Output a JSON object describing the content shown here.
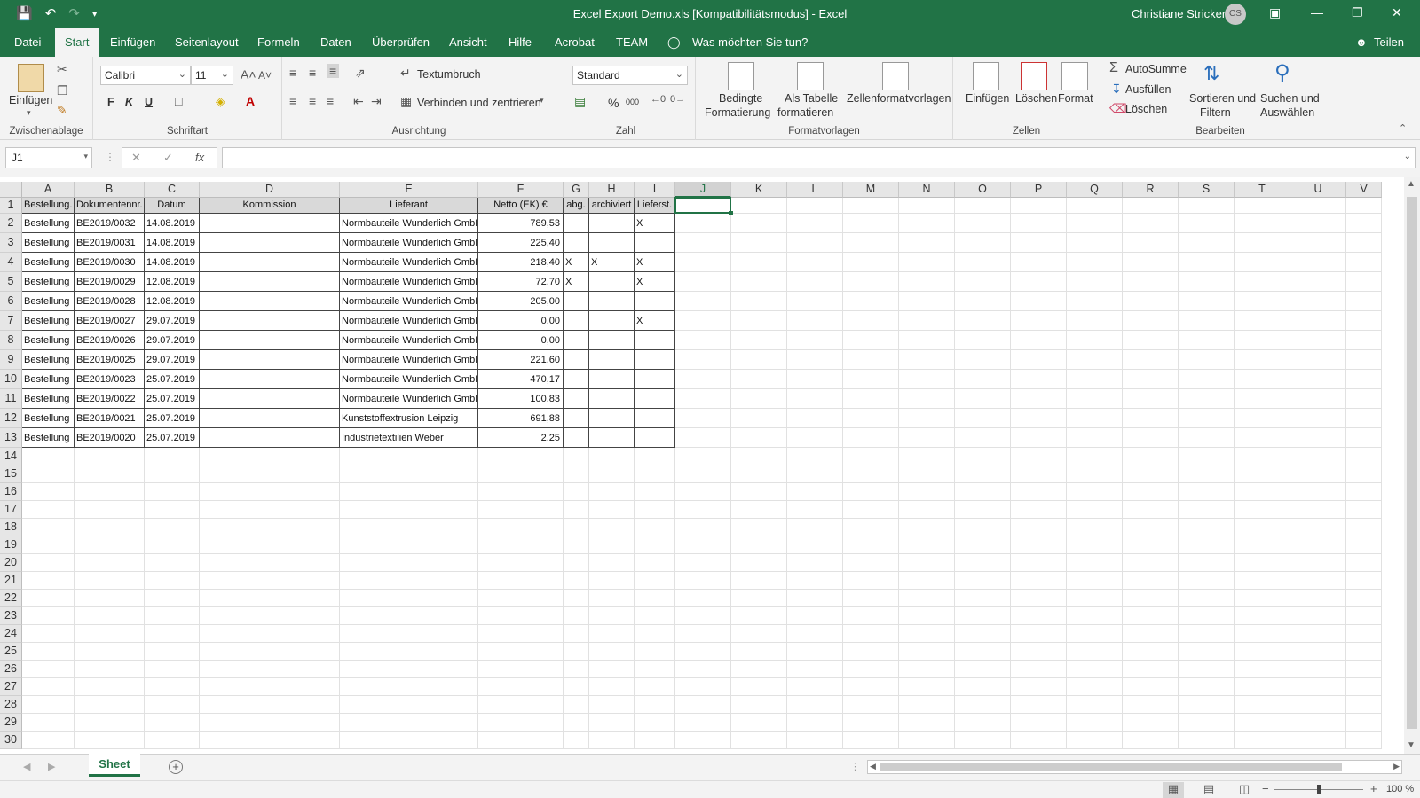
{
  "titlebar": {
    "title": "Excel Export Demo.xls  [Kompatibilitätsmodus]  -  Excel",
    "user": "Christiane Stricker",
    "initials": "CS"
  },
  "menu": {
    "tabs": [
      "Datei",
      "Start",
      "Einfügen",
      "Seitenlayout",
      "Formeln",
      "Daten",
      "Überprüfen",
      "Ansicht",
      "Hilfe",
      "Acrobat",
      "TEAM"
    ],
    "active": "Start",
    "tellme": "Was möchten Sie tun?",
    "share": "Teilen"
  },
  "ribbon": {
    "clipboard": {
      "paste": "Einfügen",
      "label": "Zwischenablage"
    },
    "font": {
      "name": "Calibri",
      "size": "11",
      "bold": "F",
      "italic": "K",
      "underline": "U",
      "label": "Schriftart"
    },
    "alignment": {
      "wrap": "Textumbruch",
      "merge": "Verbinden und zentrieren",
      "label": "Ausrichtung"
    },
    "number": {
      "format": "Standard",
      "percent": "%",
      "thousands": "000",
      "label": "Zahl"
    },
    "styles": {
      "conditional_1": "Bedingte",
      "conditional_2": "Formatierung",
      "astable_1": "Als Tabelle",
      "astable_2": "formatieren",
      "cellstyles": "Zellenformatvorlagen",
      "label": "Formatvorlagen"
    },
    "cells": {
      "insert": "Einfügen",
      "delete": "Löschen",
      "format": "Format",
      "label": "Zellen"
    },
    "editing": {
      "autosum": "AutoSumme",
      "fill": "Ausfüllen",
      "clear": "Löschen",
      "sort_1": "Sortieren und",
      "sort_2": "Filtern",
      "find_1": "Suchen und",
      "find_2": "Auswählen",
      "label": "Bearbeiten"
    }
  },
  "formula": {
    "namebox": "J1",
    "fx": "fx",
    "content": ""
  },
  "sheet": {
    "columns": [
      "A",
      "B",
      "C",
      "D",
      "E",
      "F",
      "G",
      "H",
      "I",
      "J",
      "K",
      "L",
      "M",
      "N",
      "O",
      "P",
      "Q",
      "R",
      "S",
      "T",
      "U",
      "V"
    ],
    "selected_column": "J",
    "row_numbers": [
      "1",
      "2",
      "3",
      "4",
      "5",
      "6",
      "7",
      "8",
      "9",
      "10",
      "11",
      "12",
      "13",
      "14",
      "15",
      "16",
      "17",
      "18",
      "19",
      "20",
      "21",
      "22",
      "23",
      "24",
      "25",
      "26",
      "27",
      "28",
      "29",
      "30"
    ],
    "header": [
      "Bestellung.",
      "Dokumentennr.",
      "Datum",
      "Kommission",
      "Lieferant",
      "Netto (EK) €",
      "abg.",
      "archiviert",
      "Lieferst."
    ],
    "rows": [
      [
        "Bestellung",
        "BE2019/0032",
        "14.08.2019",
        "",
        "Normbauteile Wunderlich GmbH",
        "789,53",
        "",
        "",
        "X"
      ],
      [
        "Bestellung",
        "BE2019/0031",
        "14.08.2019",
        "",
        "Normbauteile Wunderlich GmbH",
        "225,40",
        "",
        "",
        ""
      ],
      [
        "Bestellung",
        "BE2019/0030",
        "14.08.2019",
        "",
        "Normbauteile Wunderlich GmbH",
        "218,40",
        "X",
        "X",
        "X"
      ],
      [
        "Bestellung",
        "BE2019/0029",
        "12.08.2019",
        "",
        "Normbauteile Wunderlich GmbH",
        "72,70",
        "X",
        "",
        "X"
      ],
      [
        "Bestellung",
        "BE2019/0028",
        "12.08.2019",
        "",
        "Normbauteile Wunderlich GmbH",
        "205,00",
        "",
        "",
        ""
      ],
      [
        "Bestellung",
        "BE2019/0027",
        "29.07.2019",
        "",
        "Normbauteile Wunderlich GmbH",
        "0,00",
        "",
        "",
        "X"
      ],
      [
        "Bestellung",
        "BE2019/0026",
        "29.07.2019",
        "",
        "Normbauteile Wunderlich GmbH",
        "0,00",
        "",
        "",
        ""
      ],
      [
        "Bestellung",
        "BE2019/0025",
        "29.07.2019",
        "",
        "Normbauteile Wunderlich GmbH",
        "221,60",
        "",
        "",
        ""
      ],
      [
        "Bestellung",
        "BE2019/0023",
        "25.07.2019",
        "",
        "Normbauteile Wunderlich GmbH",
        "470,17",
        "",
        "",
        ""
      ],
      [
        "Bestellung",
        "BE2019/0022",
        "25.07.2019",
        "",
        "Normbauteile Wunderlich GmbH",
        "100,83",
        "",
        "",
        ""
      ],
      [
        "Bestellung",
        "BE2019/0021",
        "25.07.2019",
        "",
        "Kunststoffextrusion Leipzig",
        "691,88",
        "",
        "",
        ""
      ],
      [
        "Bestellung",
        "BE2019/0020",
        "25.07.2019",
        "",
        "Industrietextilien Weber",
        "2,25",
        "",
        "",
        ""
      ]
    ]
  },
  "tabs": {
    "sheet_name": "Sheet",
    "add": "+"
  },
  "status": {
    "zoom": "100 %",
    "minus": "−",
    "plus": "+"
  },
  "colors": {
    "accent": "#217346",
    "ribbon": "#f3f3f3",
    "header_fill": "#d9d9d9"
  }
}
